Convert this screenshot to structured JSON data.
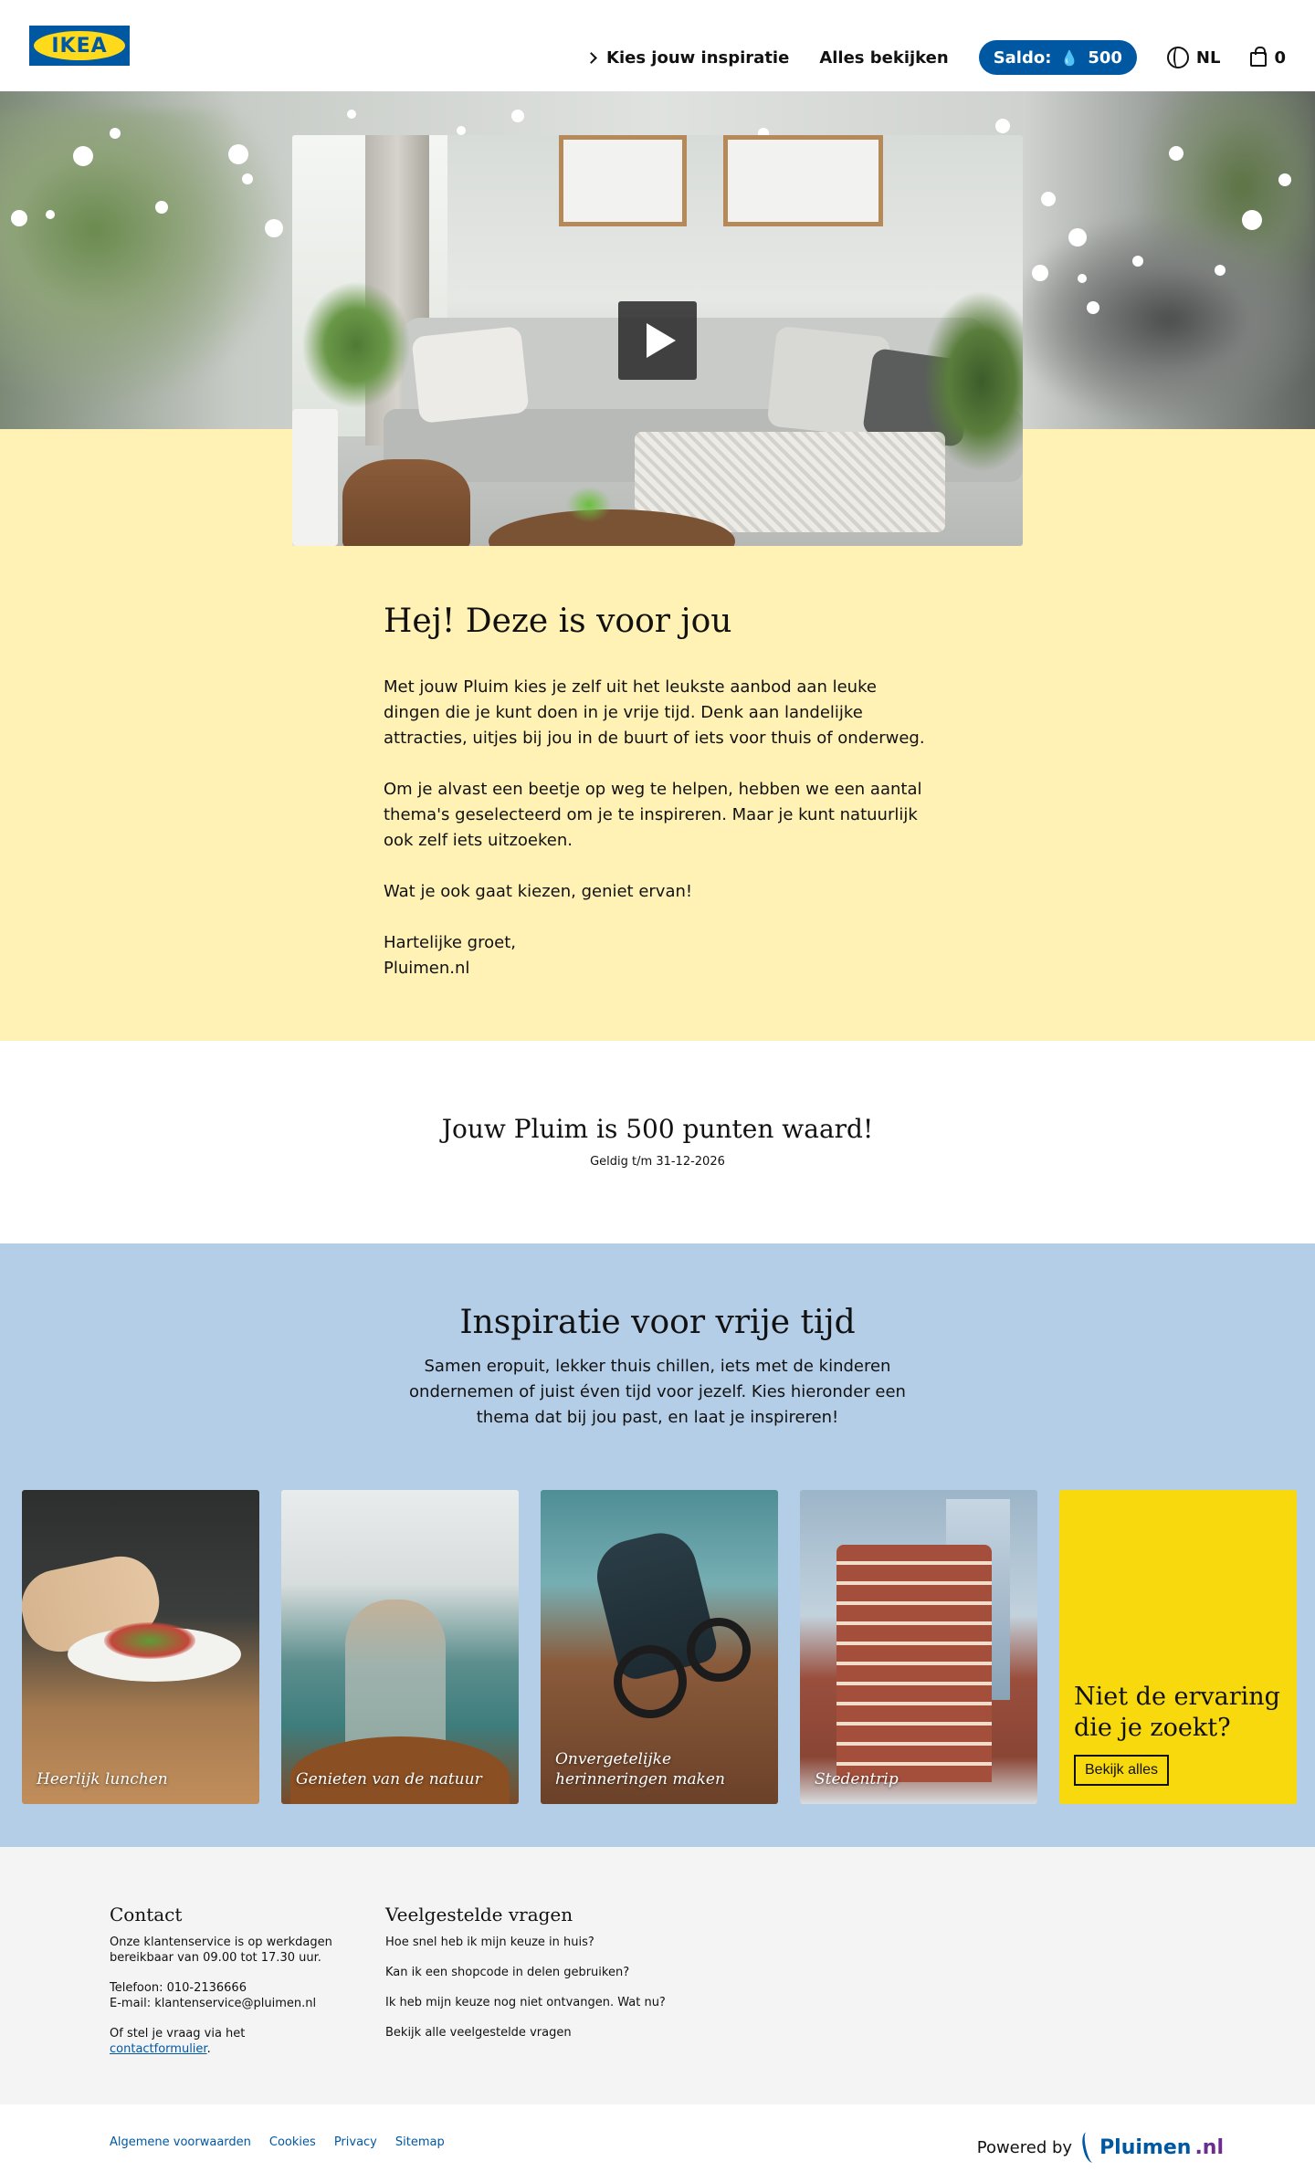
{
  "header": {
    "logo_text": "IKEA",
    "nav": {
      "inspiration_label": "Kies jouw inspiratie",
      "all_label": "Alles bekijken",
      "saldo_label": "Saldo:",
      "saldo_value": "500",
      "language": "NL",
      "cart_count": "0"
    },
    "icons": [
      "chevron-right-icon",
      "flame-icon",
      "globe-icon",
      "shopping-bag-icon"
    ]
  },
  "hero": {
    "title": "Hej! Deze is voor jou",
    "paragraphs": [
      "Met jouw Pluim kies je zelf uit het leukste aanbod aan leuke dingen die je kunt doen in je vrije tijd. Denk aan landelijke attracties, uitjes bij jou in de buurt of iets voor thuis of onderweg.",
      "Om je alvast een beetje op weg te helpen, hebben we een aantal thema's geselecteerd om je te inspireren. Maar je kunt natuurlijk ook zelf iets uitzoeken.",
      "Wat je ook gaat kiezen, geniet ervan!",
      "Hartelijke groet,",
      "Pluimen.nl"
    ]
  },
  "points": {
    "title": "Jouw Pluim is 500 punten waard!",
    "valid": "Geldig t/m 31-12-2026"
  },
  "inspiration": {
    "title": "Inspiratie voor vrije tijd",
    "lead": "Samen eropuit, lekker thuis chillen, iets met de kinderen ondernemen of juist éven tijd voor jezelf. Kies hieronder een thema dat bij jou past, en laat je inspireren!",
    "cards": [
      {
        "label": "Heerlijk lunchen"
      },
      {
        "label": "Genieten van de natuur"
      },
      {
        "label": "Onvergetelijke herinneringen maken"
      },
      {
        "label": "Stedentrip"
      }
    ],
    "cta": {
      "title": "Niet de ervaring die je zoekt?",
      "button": "Bekijk alles"
    }
  },
  "footer": {
    "contact": {
      "title": "Contact",
      "hours": "Onze klantenservice is op werkdagen bereikbaar van 09.00 tot 17.30 uur.",
      "phone": "Telefoon: 010-2136666",
      "email": "E-mail: klantenservice@pluimen.nl",
      "form_prefix": "Of stel je vraag via het",
      "form_link": "contactformulier",
      "form_suffix": "."
    },
    "faq": {
      "title": "Veelgestelde vragen",
      "items": [
        "Hoe snel heb ik mijn keuze in huis?",
        "Kan ik een shopcode in delen gebruiken?",
        "Ik heb mijn keuze nog niet ontvangen. Wat nu?",
        "Bekijk alle veelgestelde vragen"
      ]
    },
    "links": [
      "Algemene voorwaarden",
      "Cookies",
      "Privacy",
      "Sitemap"
    ],
    "powered_by": "Powered by",
    "brand_main": "Pluimen",
    "brand_tld": ".nl"
  },
  "colors": {
    "brand_blue": "#0058A3",
    "brand_yellow": "#FFDA1A",
    "hero_yellow": "#FFF2B4",
    "inspiration_blue": "#B5CEE7",
    "cta_yellow": "#F7D90D"
  }
}
